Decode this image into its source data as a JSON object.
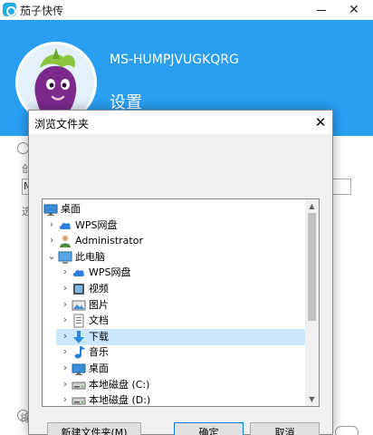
{
  "app": {
    "title": "茄子快传",
    "close_glyph": "✕",
    "device_name": "MS-HUMPJVUGKQRG",
    "settings_title": "设置",
    "background_fragments": {
      "label_1": "创",
      "field_value": "M",
      "label_2": "选",
      "label_3": "将"
    }
  },
  "dialog": {
    "title": "浏览文件夹",
    "close_glyph": "✕",
    "tree": [
      {
        "label": "桌面",
        "icon": "desktop-icon",
        "expander": "",
        "selected": false
      },
      {
        "label": "WPS网盘",
        "icon": "cloud-icon",
        "expander": "›",
        "selected": false
      },
      {
        "label": "Administrator",
        "icon": "user-icon",
        "expander": "›",
        "selected": false
      },
      {
        "label": "此电脑",
        "icon": "computer-icon",
        "expander": "⌄",
        "selected": false
      },
      {
        "label": "WPS网盘",
        "icon": "cloud-icon",
        "expander": "›",
        "selected": false
      },
      {
        "label": "视频",
        "icon": "video-icon",
        "expander": "›",
        "selected": false
      },
      {
        "label": "图片",
        "icon": "pictures-icon",
        "expander": "›",
        "selected": false
      },
      {
        "label": "文档",
        "icon": "documents-icon",
        "expander": "›",
        "selected": false
      },
      {
        "label": "下载",
        "icon": "download-icon",
        "expander": "›",
        "selected": true
      },
      {
        "label": "音乐",
        "icon": "music-icon",
        "expander": "›",
        "selected": false
      },
      {
        "label": "桌面",
        "icon": "desktop-icon",
        "expander": "›",
        "selected": false
      },
      {
        "label": "本地磁盘 (C:)",
        "icon": "drive-icon",
        "expander": "›",
        "selected": false
      },
      {
        "label": "本地磁盘 (D:)",
        "icon": "drive-icon",
        "expander": "›",
        "selected": false
      }
    ],
    "scroll_up_glyph": "▲",
    "scroll_down_glyph": "▼",
    "buttons": {
      "new_folder": "新建文件夹(M)",
      "ok": "确定",
      "cancel": "取消"
    }
  },
  "colors": {
    "header_blue": "#2a9ff2",
    "selection": "#cce8ff",
    "folder_yellow": "#f8d775",
    "accent": "#0078d7"
  }
}
